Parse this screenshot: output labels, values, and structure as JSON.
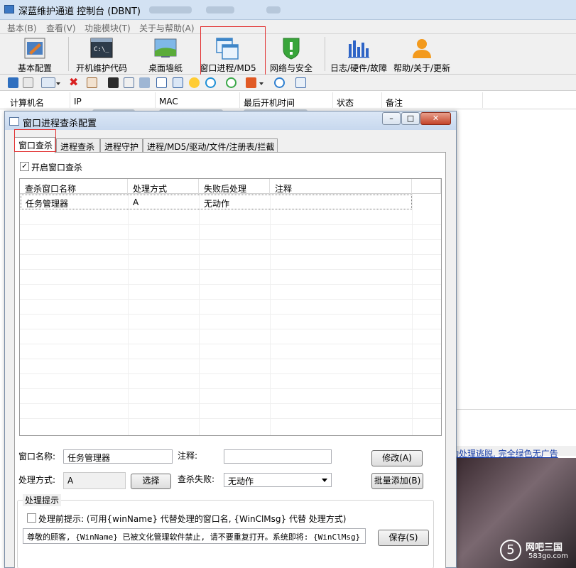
{
  "app": {
    "title": "深蓝维护通道 控制台 (DBNT)"
  },
  "menu": [
    "基本(B)",
    "查看(V)",
    "功能模块(T)",
    "关于与帮助(A)"
  ],
  "toolbar": {
    "basic": "基本配置",
    "code": "开机维护代码",
    "wallpaper": "桌面墙纸",
    "window": "窗口进程/MD5",
    "network": "网络与安全",
    "log": "日志/硬件/故障",
    "help": "帮助/关于/更新"
  },
  "list_headers": [
    "计算机名",
    "IP",
    "MAC",
    "最后开机时间",
    "状态",
    "备注"
  ],
  "background": {
    "ad_text": "动处理逃脱, 完全绿色无广告",
    "watermark_brand": "网吧三国",
    "watermark_url": "583go.com"
  },
  "dialog": {
    "title": "窗口进程查杀配置",
    "tabs": [
      "窗口查杀",
      "进程查杀",
      "进程守护",
      "进程/MD5/驱动/文件/注册表/拦截"
    ],
    "enable_label": "开启窗口查杀",
    "enable_checked": true,
    "table": {
      "headers": [
        "查杀窗口名称",
        "处理方式",
        "失败后处理",
        "注释"
      ],
      "rows": [
        [
          "任务管理器",
          "A",
          "无动作",
          ""
        ]
      ]
    },
    "form": {
      "name_label": "窗口名称:",
      "name_value": "任务管理器",
      "note_label": "注释:",
      "note_value": "",
      "modify_button": "修改(A)",
      "method_label": "处理方式:",
      "method_value": "A",
      "select_button": "选择",
      "fail_label": "查杀失败:",
      "fail_value": "无动作",
      "batch_button": "批量添加(B)"
    },
    "hint": {
      "group_label": "处理提示",
      "checkbox_label": "处理前提示: (可用{winName} 代替处理的窗口名, {WinClMsg} 代替 处理方式)",
      "checked": false,
      "message": "尊敬的顾客, {WinName} 已被文化管理软件禁止, 请不要重复打开。系统即将: {WinClMsg}",
      "save_button": "保存(S)"
    }
  }
}
